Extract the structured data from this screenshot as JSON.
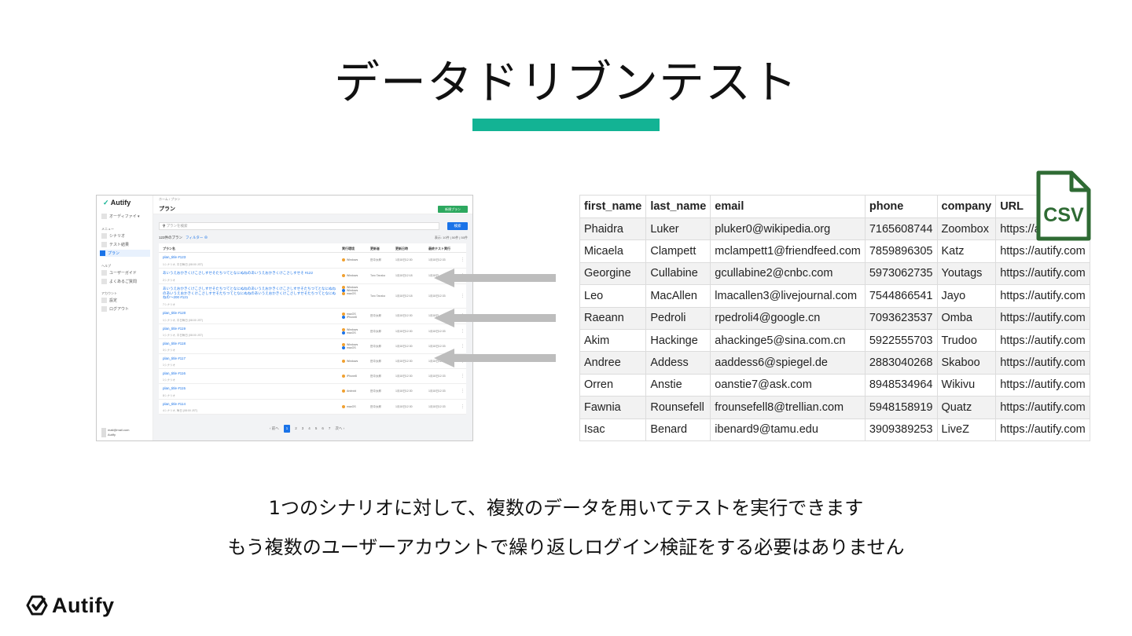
{
  "slide": {
    "title": "データドリブンテスト",
    "caption_1": "1つのシナリオに対して、複数のデータを用いてテストを実行できます",
    "caption_2": "もう複数のユーザーアカウントで繰り返しログイン検証をする必要はありません",
    "footer_logo": "Autify",
    "accent_color": "#13b394"
  },
  "app_screenshot": {
    "logo": "Autify",
    "sidebar": {
      "org_selector": "オーディファイ ▾",
      "menu_heading": "メニュー",
      "items": [
        "シナリオ",
        "テスト結果",
        "プラン"
      ],
      "help_heading": "ヘルプ",
      "help_items": [
        "ユーザーガイド",
        "よくあるご質問"
      ],
      "account_heading": "アカウント",
      "account_items": [
        "設定",
        "ログアウト"
      ],
      "footer_email": "mail@mail.com",
      "footer_org": "Autify"
    },
    "breadcrumb": "ホーム / プラン",
    "page_title": "プラン",
    "new_plan_button": "新規プラン",
    "search_placeholder": "プランを検索",
    "search_button": "検索",
    "count_label": "123件のプラン",
    "filter_label": "フィルター",
    "paging_label": "表示: 10件 | 50件 | 50件",
    "columns": [
      "プラン名",
      "実行環境",
      "更新者",
      "更新日時",
      "最終テスト実行"
    ],
    "rows": [
      {
        "name": "plan_title #123",
        "sub": "1シナリオ, 平日毎日 (08:00 JST)",
        "env": "Windows",
        "env2": "",
        "env3": "",
        "user": "田中太郎",
        "updated": "1月18日12:30",
        "last": "1月18日12:33"
      },
      {
        "name": "あいうえおかきくけこさしすせそたちつてとなにぬねのあいうえおかきくけこさしすせそ #122",
        "sub": "2シナリオ",
        "env": "Windows",
        "env2": "",
        "env3": "",
        "user": "Taro Tanaka",
        "updated": "1月18日12:18",
        "last": "1月18日"
      },
      {
        "name": "あいうえおかきくけこさしすせそたちつてとなにぬねのあいうえおかきくけこさしすせそたちつてとなにぬねのあいうえおかきくけこさしすせそたちつてとなにぬねのあいうえおかきくけこさしすせそたちつてとなにぬねの〜200 #121",
        "sub": "7シナリオ",
        "env": "Windows",
        "env2": "Windows",
        "env3": "macOS",
        "user": "Taro Tanaka",
        "updated": "1月18日12:18",
        "last": "1月18日12:33"
      },
      {
        "name": "plan_title #120",
        "sub": "1シナリオ, 平日毎日 (08:00 JST)",
        "env": "macOS",
        "env2": "iPhone8",
        "env3": "",
        "user": "田中太郎",
        "updated": "1月18日12:30",
        "last": "1月18日"
      },
      {
        "name": "plan_title #119",
        "sub": "1シナリオ, 平日毎日 (08:00 JST)",
        "env": "Windows",
        "env2": "macOS",
        "env3": "",
        "user": "田中太郎",
        "updated": "1月18日12:30",
        "last": "1月18日12:33"
      },
      {
        "name": "plan_title #118",
        "sub": "3シナリオ",
        "env": "Windows",
        "env2": "macOS",
        "env3": "",
        "user": "田中太郎",
        "updated": "1月18日12:30",
        "last": "1月18日12:33"
      },
      {
        "name": "plan_title #117",
        "sub": "1シナリオ",
        "env": "Windows",
        "env2": "",
        "env3": "",
        "user": "田中太郎",
        "updated": "1月18日12:30",
        "last": "1月18日12:33"
      },
      {
        "name": "plan_title #116",
        "sub": "1シナリオ",
        "env": "iPhone8",
        "env2": "",
        "env3": "",
        "user": "田中太郎",
        "updated": "1月18日12:30",
        "last": "1月18日12:33"
      },
      {
        "name": "plan_title #115",
        "sub": "8シナリオ",
        "env": "Android",
        "env2": "",
        "env3": "",
        "user": "田中太郎",
        "updated": "1月18日12:30",
        "last": "1月18日12:33"
      },
      {
        "name": "plan_title #114",
        "sub": "4シナリオ, 毎日 (08:00 JST)",
        "env": "macOS",
        "env2": "",
        "env3": "",
        "user": "田中太郎",
        "updated": "1月18日12:30",
        "last": "1月18日12:33"
      }
    ],
    "pagination": [
      "‹ 前へ",
      "1",
      "2",
      "3",
      "4",
      "5",
      "6",
      "7",
      "次へ ›"
    ]
  },
  "csv_icon_label": "CSV",
  "csv": {
    "headers": [
      "first_name",
      "last_name",
      "email",
      "phone",
      "company",
      "URL"
    ],
    "rows": [
      [
        "Phaidra",
        "Luker",
        "pluker0@wikipedia.org",
        "7165608744",
        "Zoombox",
        "https://aut"
      ],
      [
        "Micaela",
        "Clampett",
        "mclampett1@friendfeed.com",
        "7859896305",
        "Katz",
        "https://autify.com"
      ],
      [
        "Georgine",
        "Cullabine",
        "gcullabine2@cnbc.com",
        "5973062735",
        "Youtags",
        "https://autify.com"
      ],
      [
        "Leo",
        "MacAllen",
        "lmacallen3@livejournal.com",
        "7544866541",
        "Jayo",
        "https://autify.com"
      ],
      [
        "Raeann",
        "Pedroli",
        "rpedroli4@google.cn",
        "7093623537",
        "Omba",
        "https://autify.com"
      ],
      [
        "Akim",
        "Hackinge",
        "ahackinge5@sina.com.cn",
        "5922555703",
        "Trudoo",
        "https://autify.com"
      ],
      [
        "Andree",
        "Addess",
        "aaddess6@spiegel.de",
        "2883040268",
        "Skaboo",
        "https://autify.com"
      ],
      [
        "Orren",
        "Anstie",
        "oanstie7@ask.com",
        "8948534964",
        "Wikivu",
        "https://autify.com"
      ],
      [
        "Fawnia",
        "Rounsefell",
        "frounsefell8@trellian.com",
        "5948158919",
        "Quatz",
        "https://autify.com"
      ],
      [
        "Isac",
        "Benard",
        "ibenard9@tamu.edu",
        "3909389253",
        "LiveZ",
        "https://autify.com"
      ]
    ]
  }
}
